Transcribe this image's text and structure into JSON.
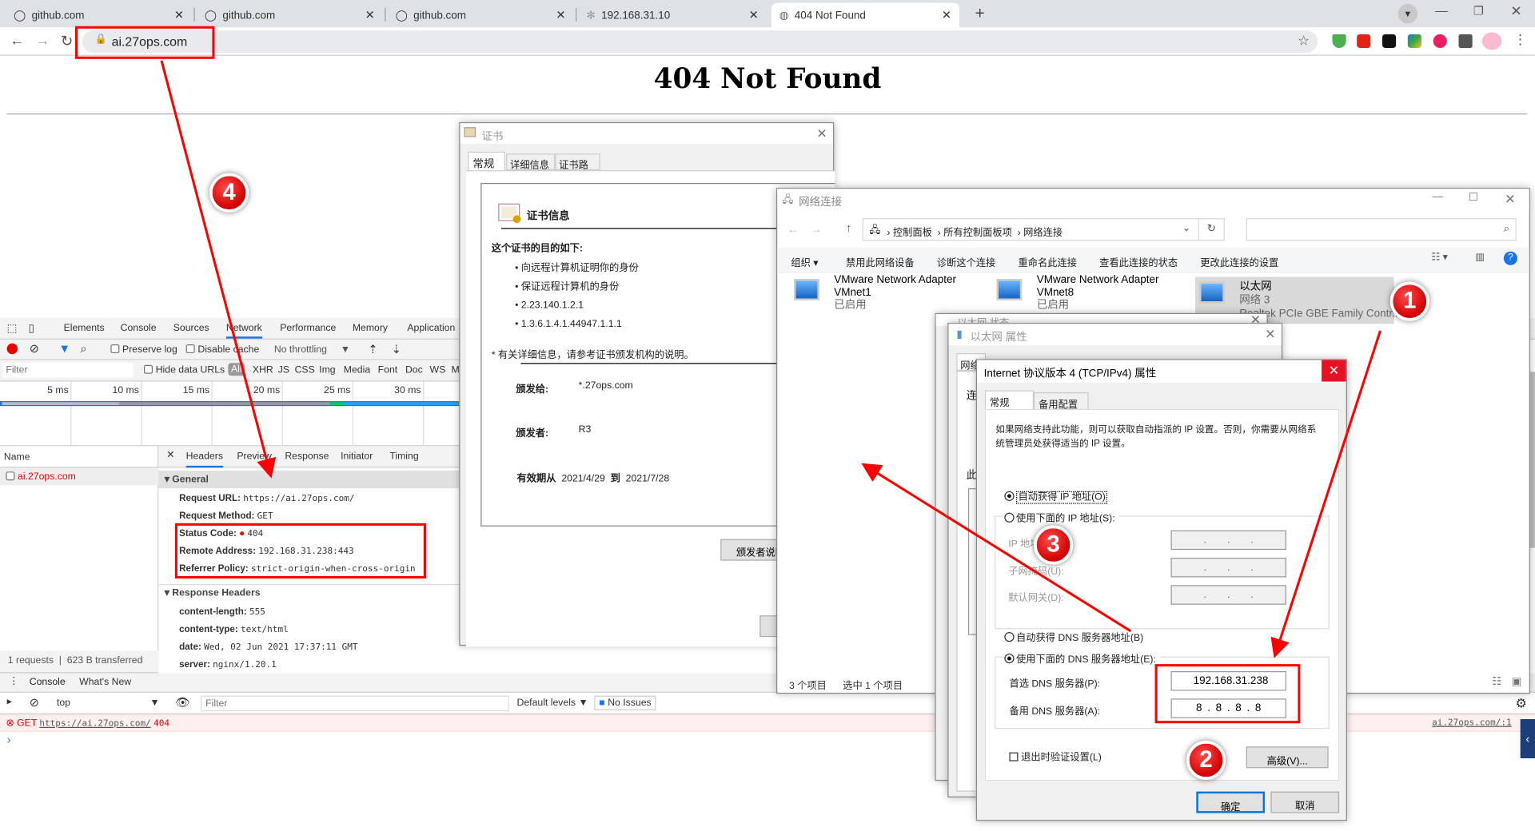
{
  "browser": {
    "tabs": [
      {
        "title": "github.com",
        "icon": "github-icon"
      },
      {
        "title": "github.com",
        "icon": "github-icon"
      },
      {
        "title": "github.com",
        "icon": "github-icon"
      },
      {
        "title": "192.168.31.10",
        "icon": "gear-icon"
      },
      {
        "title": "404 Not Found",
        "icon": "globe-icon",
        "active": true
      }
    ],
    "tab_close": "✕",
    "new_tab": "+",
    "url": "ai.27ops.com",
    "extensions": [
      "adguard-icon",
      "youtube-icon",
      "tampermonkey-icon",
      "idm-icon",
      "t-icon",
      "puzzle-icon",
      "profile-avatar"
    ]
  },
  "page": {
    "heading": "404 Not Found"
  },
  "devtools": {
    "tabs": [
      "Elements",
      "Console",
      "Sources",
      "Network",
      "Performance",
      "Memory",
      "Application"
    ],
    "active_tab": "Network",
    "toolbar": {
      "preserve_log": "Preserve log",
      "disable_cache": "Disable cache",
      "throttling": "No throttling"
    },
    "filter_placeholder": "Filter",
    "hide_data_urls": "Hide data URLs",
    "type_filters": [
      "All",
      "XHR",
      "JS",
      "CSS",
      "Img",
      "Media",
      "Font",
      "Doc",
      "WS",
      "M"
    ],
    "timeline_ticks": [
      "5 ms",
      "10 ms",
      "15 ms",
      "20 ms",
      "25 ms",
      "30 ms"
    ],
    "name_header": "Name",
    "requests": [
      {
        "name": "ai.27ops.com",
        "status_color": "#e00000"
      }
    ],
    "detail_tabs": [
      "Headers",
      "Preview",
      "Response",
      "Initiator",
      "Timing"
    ],
    "general_title": "General",
    "general": [
      {
        "key": "Request URL:",
        "value": "https://ai.27ops.com/"
      },
      {
        "key": "Request Method:",
        "value": "GET"
      },
      {
        "key": "Status Code:",
        "value": "404"
      },
      {
        "key": "Remote Address:",
        "value": "192.168.31.238:443"
      },
      {
        "key": "Referrer Policy:",
        "value": "strict-origin-when-cross-origin"
      }
    ],
    "response_headers_title": "Response Headers",
    "response_headers": [
      {
        "key": "content-length:",
        "value": "555"
      },
      {
        "key": "content-type:",
        "value": "text/html"
      },
      {
        "key": "date:",
        "value": "Wed, 02 Jun 2021 17:37:11 GMT"
      },
      {
        "key": "server:",
        "value": "nginx/1.20.1"
      }
    ],
    "summary": {
      "requests": "1 requests",
      "transferred": "623 B transferred"
    },
    "drawer_tabs": [
      "Console",
      "What's New"
    ],
    "console": {
      "context": "top",
      "filter_placeholder": "Filter",
      "levels": "Default levels ▼",
      "issues": "No Issues",
      "error": {
        "method": "GET",
        "url": "https://ai.27ops.com/",
        "code": "404",
        "source": "ai.27ops.com/:1"
      },
      "prompt": "›"
    }
  },
  "cert_dialog": {
    "title": "证书",
    "tabs": [
      "常规",
      "详细信息",
      "证书路径"
    ],
    "info_title": "证书信息",
    "purpose_title": "这个证书的目的如下:",
    "purposes": [
      "向远程计算机证明你的身份",
      "保证远程计算机的身份",
      "2.23.140.1.2.1",
      "1.3.6.1.4.1.44947.1.1.1"
    ],
    "note": "* 有关详细信息，请参考证书颁发机构的说明。",
    "issued_to_label": "颁发给:",
    "issued_to": "*.27ops.com",
    "issued_by_label": "颁发者:",
    "issued_by": "R3",
    "valid_from_label": "有效期从",
    "valid_from": "2021/4/29",
    "valid_to_label": "到",
    "valid_to": "2021/7/28",
    "issuer_statement_button": "颁发者说明"
  },
  "net_connections": {
    "title": "网络连接",
    "breadcrumb": [
      "控制面板",
      "所有控制面板项",
      "网络连接"
    ],
    "commands": [
      "组织 ▾",
      "禁用此网络设备",
      "诊断这个连接",
      "重命名此连接",
      "查看此连接的状态",
      "更改此连接的设置"
    ],
    "items": [
      {
        "name": "VMware Network Adapter VMnet1",
        "line2": "已启用",
        "line3": ""
      },
      {
        "name": "VMware Network Adapter VMnet8",
        "line2": "已启用",
        "line3": ""
      },
      {
        "name": "以太网",
        "line2": "网络 3",
        "line3": "Realtek PCIe GBE Family Contr...",
        "selected": true
      }
    ],
    "status_count": "3 个项目",
    "status_selected": "选中 1 个项目"
  },
  "eth_status": {
    "title": "以太网 状态"
  },
  "eth_props": {
    "title": "以太网 属性",
    "tab": "网络",
    "label_connect": "连",
    "label_this": "此"
  },
  "ipv4": {
    "title": "Internet 协议版本 4 (TCP/IPv4) 属性",
    "tabs": [
      "常规",
      "备用配置"
    ],
    "description": "如果网络支持此功能，则可以获取自动指派的 IP 设置。否则，你需要从网络系统管理员处获得适当的 IP 设置。",
    "auto_ip": "自动获得 IP 地址(O)",
    "manual_ip": "使用下面的 IP 地址(S):",
    "ip_label": "IP 地址(I):",
    "mask_label": "子网掩码(U):",
    "gateway_label": "默认网关(D):",
    "auto_dns": "自动获得 DNS 服务器地址(B)",
    "manual_dns": "使用下面的 DNS 服务器地址(E):",
    "preferred_dns_label": "首选 DNS 服务器(P):",
    "preferred_dns": [
      "192",
      "168",
      "31",
      "238"
    ],
    "alternate_dns_label": "备用 DNS 服务器(A):",
    "alternate_dns": [
      "8",
      "8",
      "8",
      "8"
    ],
    "validate": "退出时验证设置(L)",
    "advanced": "高级(V)...",
    "ok": "确定",
    "cancel": "取消",
    "ip_mode": "auto",
    "dns_mode": "manual"
  },
  "annotations": {
    "badges": [
      "1",
      "2",
      "3",
      "4"
    ],
    "color": "#ff0000"
  }
}
